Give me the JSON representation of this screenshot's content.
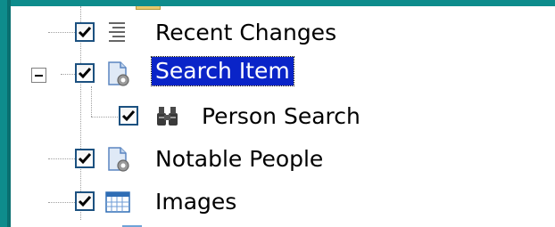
{
  "tree": {
    "items": [
      {
        "label": "Recent Changes",
        "checked": true,
        "icon": "list-lines-icon",
        "level": 1
      },
      {
        "label": "Search Item",
        "checked": true,
        "icon": "document-gear-icon",
        "level": 1,
        "expanded": true,
        "selected": true
      },
      {
        "label": "Person Search",
        "checked": true,
        "icon": "binoculars-icon",
        "level": 2
      },
      {
        "label": "Notable People",
        "checked": true,
        "icon": "document-gear-icon",
        "level": 1
      },
      {
        "label": "Images",
        "checked": true,
        "icon": "grid-table-icon",
        "level": 1
      }
    ]
  },
  "colors": {
    "selection": "#0a24c8",
    "frame": "#0e8c8c",
    "checkbox_border": "#1c5180"
  }
}
